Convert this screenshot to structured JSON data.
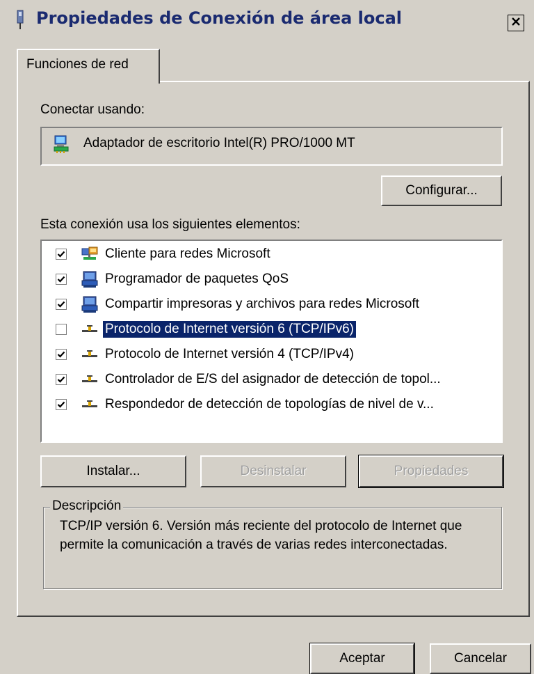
{
  "window": {
    "title": "Propiedades de Conexión de área local",
    "close_symbol": "✕"
  },
  "tabs": [
    {
      "label": "Funciones de red",
      "selected": true
    }
  ],
  "connect_using": {
    "label": "Conectar usando:",
    "adapter_name": "Adaptador de escritorio Intel(R) PRO/1000 MT",
    "adapter_icon": "network-adapter-icon"
  },
  "configure_button": "Configurar...",
  "components": {
    "label": "Esta conexión usa los siguientes elementos:",
    "items": [
      {
        "label": "Cliente para redes Microsoft",
        "checked": true,
        "selected": false,
        "icon": "network-client-icon"
      },
      {
        "label": "Programador de paquetes QoS",
        "checked": true,
        "selected": false,
        "icon": "network-service-icon"
      },
      {
        "label": "Compartir impresoras y archivos para redes Microsoft",
        "checked": true,
        "selected": false,
        "icon": "network-service-icon"
      },
      {
        "label": "Protocolo de Internet versión 6 (TCP/IPv6)",
        "checked": false,
        "selected": true,
        "icon": "protocol-icon"
      },
      {
        "label": "Protocolo de Internet versión 4 (TCP/IPv4)",
        "checked": true,
        "selected": false,
        "icon": "protocol-icon"
      },
      {
        "label": "Controlador de E/S del asignador de detección de topol...",
        "checked": true,
        "selected": false,
        "icon": "protocol-icon"
      },
      {
        "label": "Respondedor de detección de topologías de nivel de v...",
        "checked": true,
        "selected": false,
        "icon": "protocol-icon"
      }
    ]
  },
  "component_buttons": {
    "install": {
      "label": "Instalar...",
      "enabled": true
    },
    "uninstall": {
      "label": "Desinstalar",
      "enabled": false
    },
    "properties": {
      "label": "Propiedades",
      "enabled": false
    }
  },
  "description": {
    "label": "Descripción",
    "text": "TCP/IP versión 6. Versión más reciente del protocolo de Internet que permite la comunicación a través de varias redes interconectadas."
  },
  "footer": {
    "ok": "Aceptar",
    "cancel": "Cancelar"
  },
  "colors": {
    "selection": "#0a246a",
    "title_text": "#1a2a70",
    "dialog_bg": "#d4d0c8"
  }
}
